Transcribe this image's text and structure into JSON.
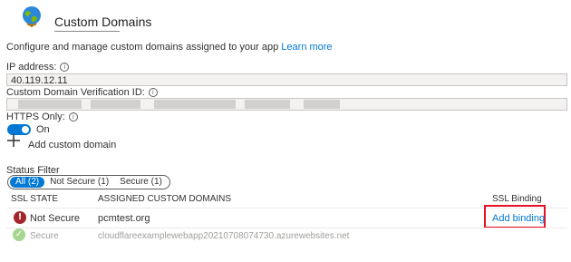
{
  "header": {
    "title": "Custom Domains",
    "icon": "globe-icon"
  },
  "description": {
    "text": "Configure and manage custom domains assigned to your app ",
    "link": "Learn more"
  },
  "ip_address": {
    "label": "IP address:",
    "value": "40.119.12.11"
  },
  "verification_id": {
    "label": "Custom Domain Verification ID:",
    "value": ""
  },
  "https_only": {
    "label": "HTTPS Only:",
    "state": "On"
  },
  "add_domain": {
    "label": "Add custom domain"
  },
  "status_filter": {
    "label": "Status Filter",
    "options": [
      "All (2)",
      "Not Secure (1)",
      "Secure (1)"
    ],
    "selected": "All (2)"
  },
  "table": {
    "columns": [
      "SSL STATE",
      "ASSIGNED CUSTOM DOMAINS",
      "SSL Binding"
    ],
    "rows": [
      {
        "state": "Not Secure",
        "domain": "pcmtest.org",
        "binding": "Add binding",
        "status_color": "#a4262c"
      },
      {
        "state": "Secure",
        "domain": "cloudflareexamplewebapp20210708074730.azurewebsites.net",
        "binding": "",
        "status_color": "#6bb700"
      }
    ]
  },
  "colors": {
    "accent": "#0078d4",
    "highlight_box": "#e81123"
  }
}
